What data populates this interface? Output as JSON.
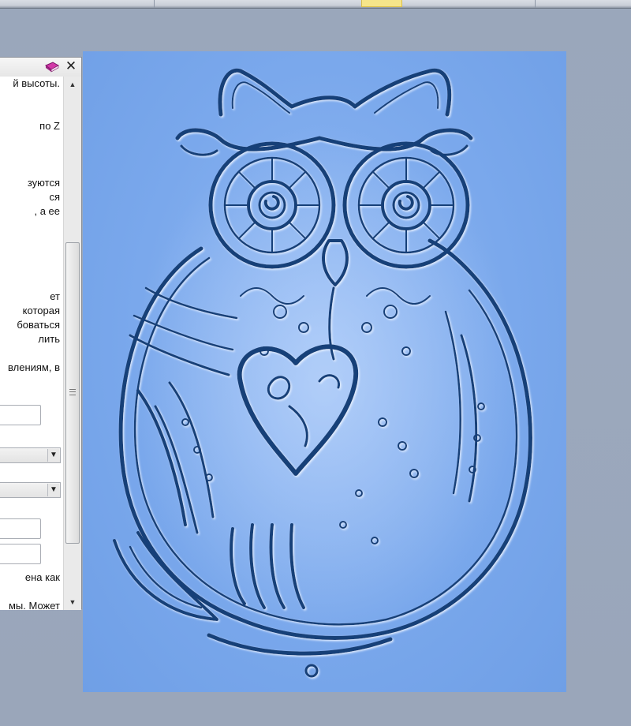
{
  "colors": {
    "relief_background": "#7eaaef",
    "relief_line": "#163f78",
    "panel_background": "#f0f0f0",
    "workspace_background": "#9aa7bb",
    "tab_highlight": "#f6e58a"
  },
  "icons": {
    "panel_book": "book-icon",
    "panel_close": "close-icon",
    "scroll_up": "scroll-up-icon",
    "scroll_down": "scroll-down-icon",
    "combo_arrow": "dropdown-arrow-icon"
  },
  "panel": {
    "close_symbol": "✕",
    "text_lines": [
      "й высоты.",
      "по Z",
      "зуются",
      "ся",
      ", а ее",
      "ет",
      "которая",
      "боваться",
      "лить",
      "влениям, в",
      "ена как",
      "мы. Может"
    ],
    "dropdown_arrow": "▼",
    "scroll_up_symbol": "▲",
    "scroll_down_symbol": "▼"
  },
  "viewport": {
    "content": "owl-relief-model"
  }
}
